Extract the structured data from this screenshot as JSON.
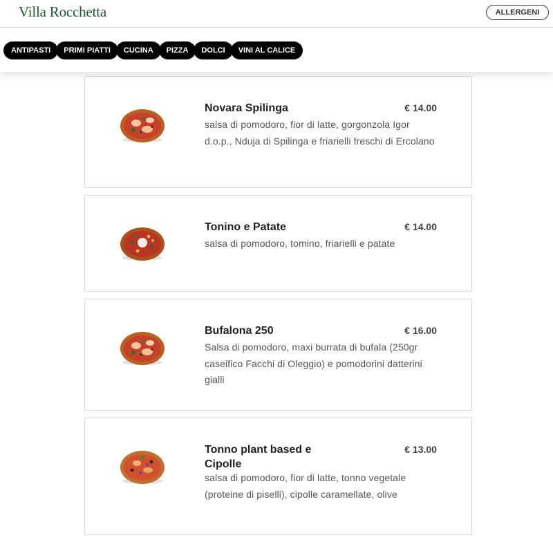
{
  "header": {
    "brand": "Villa Rocchetta",
    "allergeni_label": "ALLERGENI"
  },
  "categories": [
    "ANTIPASTI",
    "PRIMI PIATTI",
    "CUCINA",
    "PIZZA",
    "DOLCI",
    "VINI AL CALICE"
  ],
  "items": [
    {
      "name": "Novara Spilinga",
      "price": "€ 14.00",
      "description": "salsa di pomodoro, fior di latte, gorgonzola Igor d.o.p., Nduja di Spilinga e friarielli freschi di Ercolano"
    },
    {
      "name": "Tonino e Patate",
      "price": "€ 14.00",
      "description": "salsa di pomodoro, tomino, friarielli e patate"
    },
    {
      "name": "Bufalona 250",
      "price": "€ 16.00",
      "description": "Salsa di pomodoro, maxi burrata di bufala (250gr caseifico Facchi di Oleggio) e pomodorini datterini gialli"
    },
    {
      "name": "Tonno plant based e Cipolle",
      "price": "€ 13.00",
      "description": "salsa di pomodoro, fior di latte, tonno vegetale (proteine di piselli), cipolle caramellate, olive"
    }
  ],
  "colors": {
    "brand": "#1f5a2e",
    "tab_bg": "#000000",
    "tab_text": "#ffffff",
    "card_border": "#d9d9d9"
  }
}
